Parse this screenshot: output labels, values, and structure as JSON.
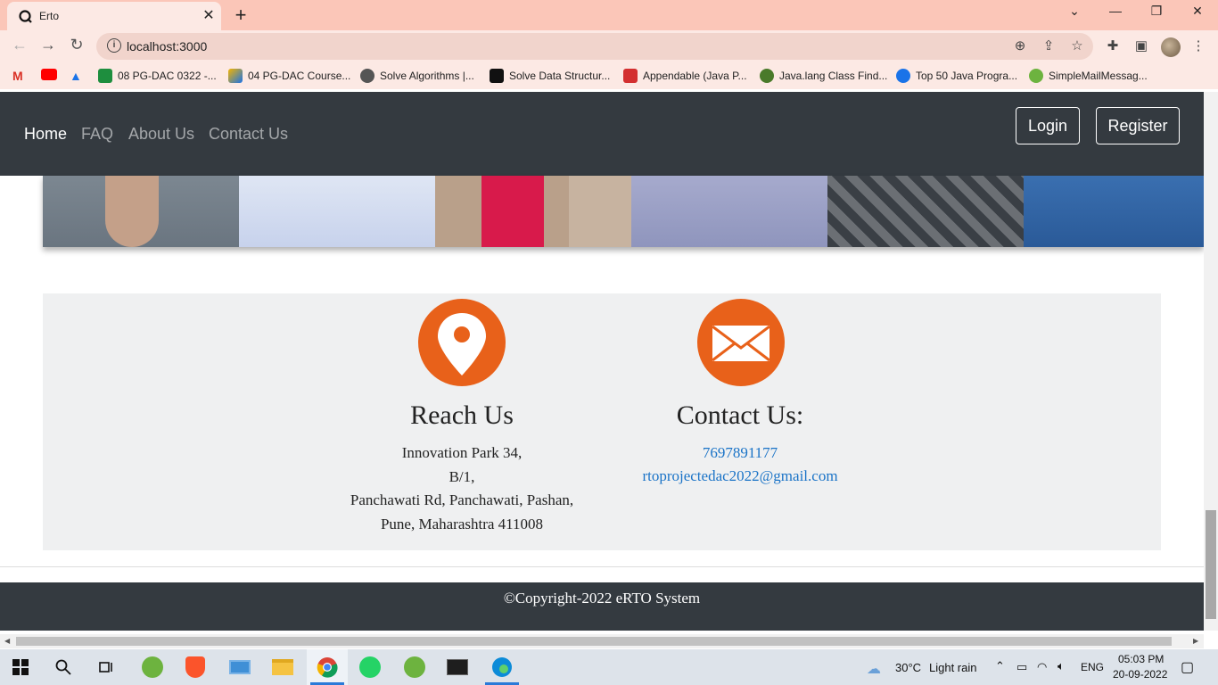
{
  "browser": {
    "tab_title": "Erto",
    "url": "localhost:3000",
    "bookmarks": [
      {
        "label": "08 PG-DAC 0322 -...",
        "color": "#1e8e3e"
      },
      {
        "label": "04 PG-DAC Course...",
        "color": "#f4b400"
      },
      {
        "label": "Solve Algorithms |...",
        "color": "#555555"
      },
      {
        "label": "Solve Data Structur...",
        "color": "#111111"
      },
      {
        "label": "Appendable (Java P...",
        "color": "#d32f2f"
      },
      {
        "label": "Java.lang Class Find...",
        "color": "#4a7a2a"
      },
      {
        "label": "Top 50 Java Progra...",
        "color": "#1a73e8"
      },
      {
        "label": "SimpleMailMessag...",
        "color": "#6db33f"
      }
    ]
  },
  "navbar": {
    "links": [
      "Home",
      "FAQ",
      "About Us",
      "Contact Us"
    ],
    "login": "Login",
    "register": "Register"
  },
  "reach": {
    "heading": "Reach Us",
    "lines": [
      "Innovation Park 34,",
      "B/1,",
      "Panchawati Rd, Panchawati, Pashan,",
      "Pune, Maharashtra 411008"
    ]
  },
  "contact": {
    "heading": "Contact Us:",
    "phone": "7697891177",
    "email": "rtoprojectedac2022@gmail.com"
  },
  "footer": {
    "text": "©Copyright-2022 eRTO System"
  },
  "taskbar": {
    "weather_temp": "30°C",
    "weather_desc": "Light rain",
    "lang": "ENG",
    "time": "05:03 PM",
    "date": "20-09-2022"
  },
  "colors": {
    "accent_orange": "#e8611a",
    "navbar_dark": "#343a40",
    "link_blue": "#1a73c7"
  }
}
